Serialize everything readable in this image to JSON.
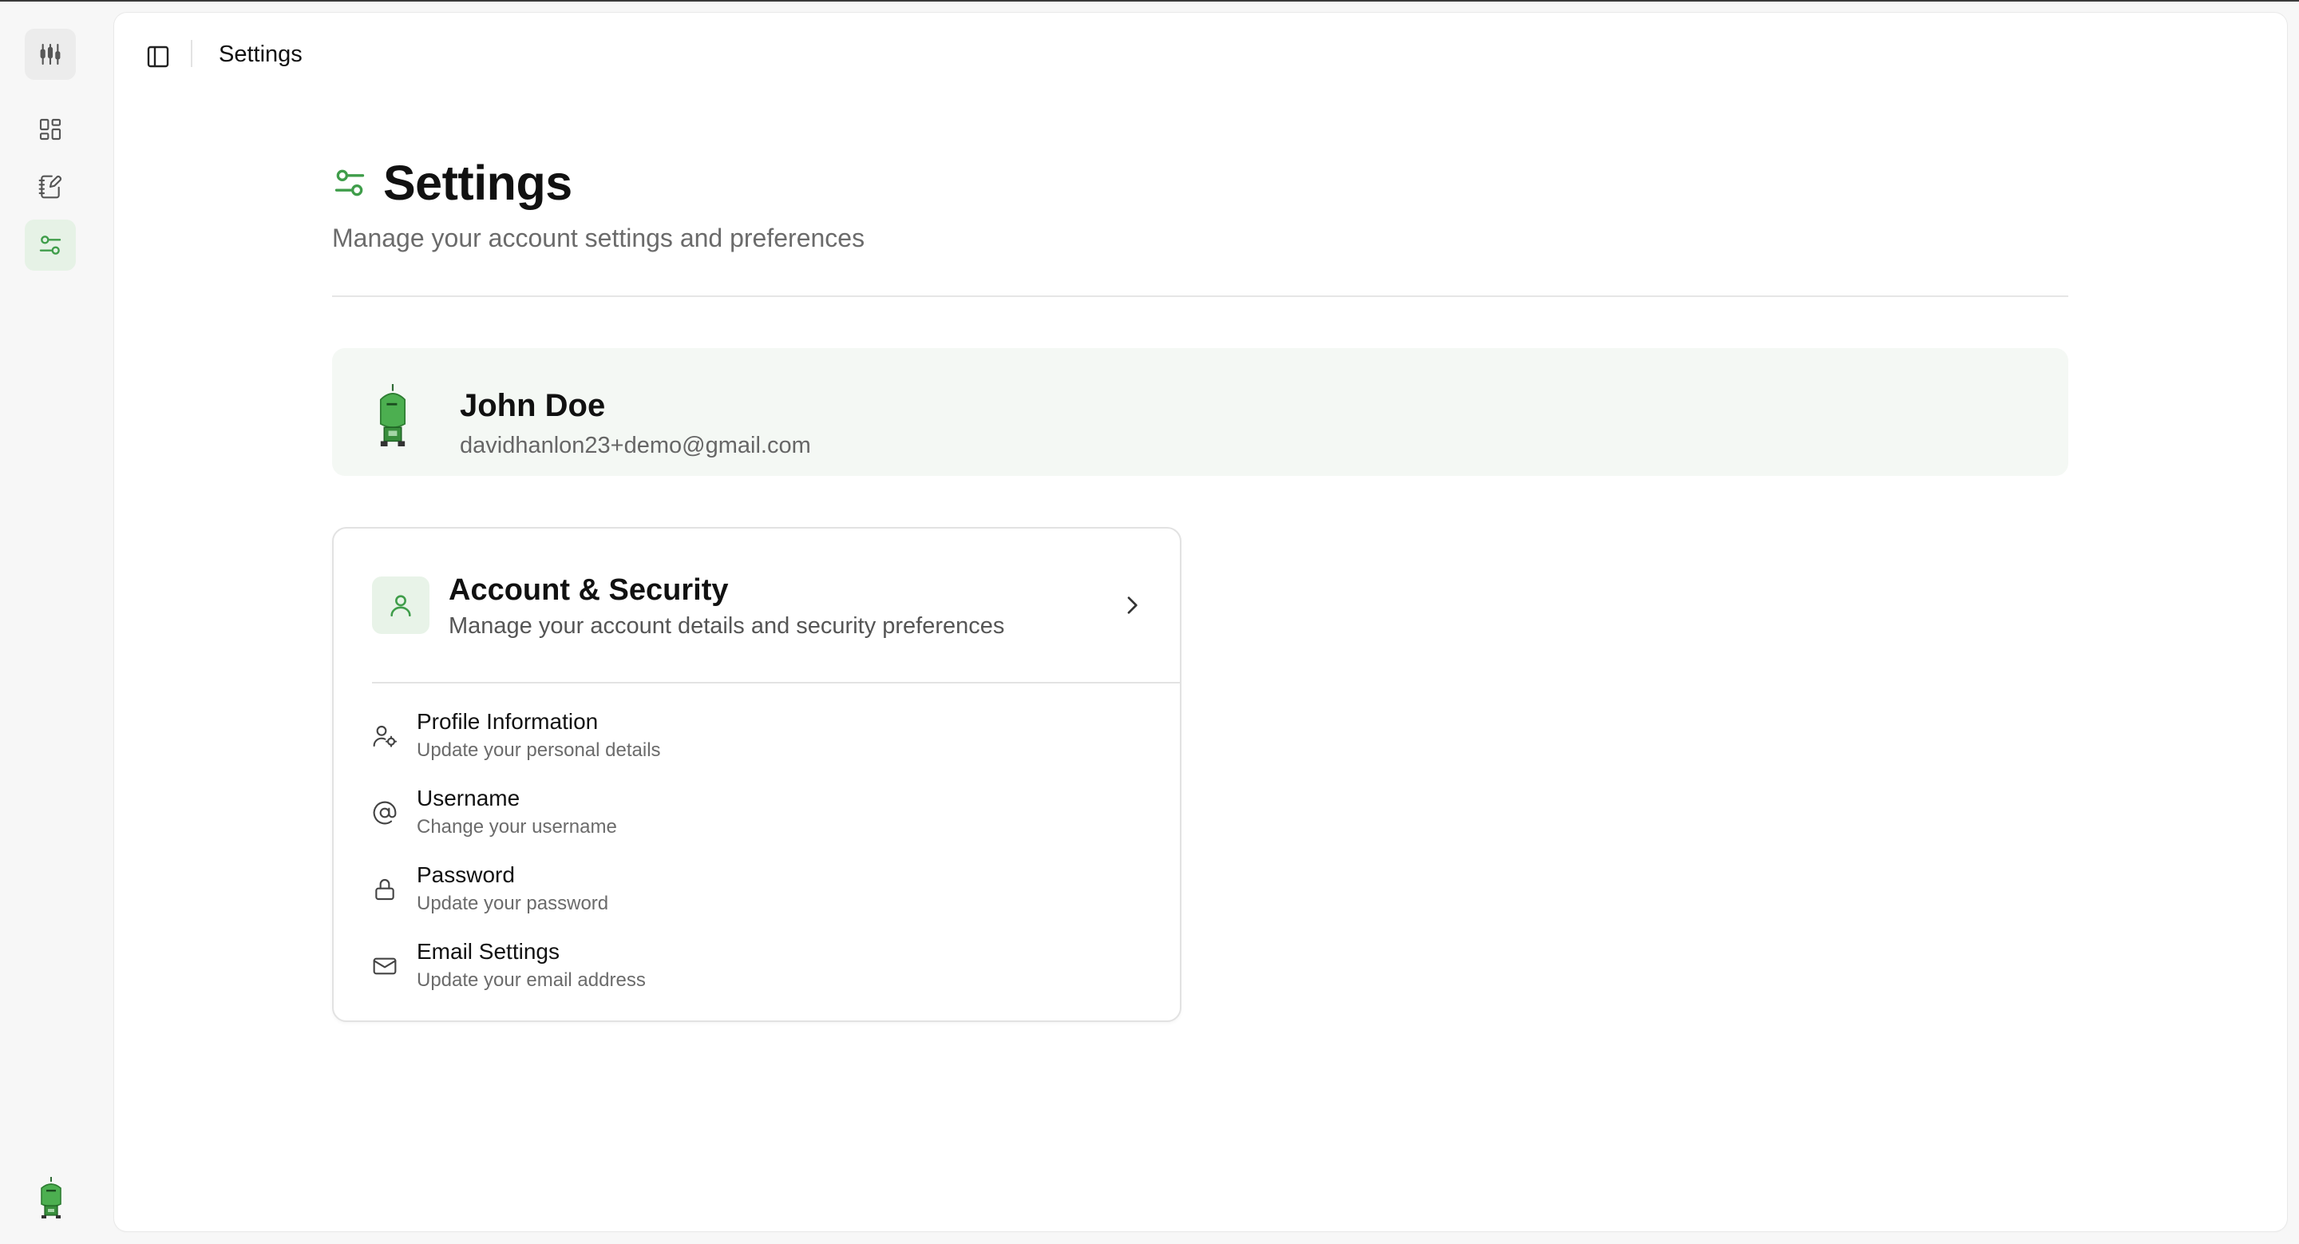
{
  "header": {
    "breadcrumb": "Settings"
  },
  "page": {
    "title": "Settings",
    "subtitle": "Manage your account settings and preferences"
  },
  "profile": {
    "name": "John Doe",
    "email": "davidhanlon23+demo@gmail.com"
  },
  "account_section": {
    "title": "Account & Security",
    "description": "Manage your account details and security preferences",
    "items": [
      {
        "title": "Profile Information",
        "description": "Update your personal details",
        "icon": "user-cog-icon"
      },
      {
        "title": "Username",
        "description": "Change your username",
        "icon": "at-sign-icon"
      },
      {
        "title": "Password",
        "description": "Update your password",
        "icon": "lock-icon"
      },
      {
        "title": "Email Settings",
        "description": "Update your email address",
        "icon": "mail-icon"
      }
    ]
  },
  "sidebar": {
    "items": [
      {
        "name": "logo",
        "icon": "candlestick-chart-icon"
      },
      {
        "name": "dashboard",
        "icon": "layout-grid-icon"
      },
      {
        "name": "notes",
        "icon": "notebook-pen-icon"
      },
      {
        "name": "settings",
        "icon": "sliders-icon",
        "active": true
      }
    ]
  },
  "colors": {
    "accent": "#3f9d4a",
    "accent_bg": "#e6f2e6",
    "card_bg": "#f4f8f4"
  }
}
